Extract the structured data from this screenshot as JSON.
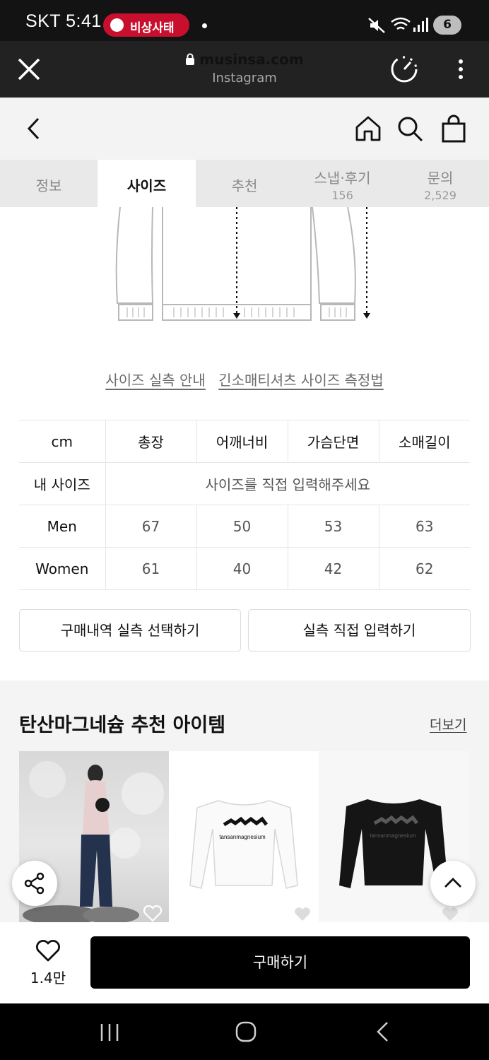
{
  "status_bar": {
    "carrier_time": "SKT 5:41",
    "notification": "비상사태",
    "battery": "6"
  },
  "browser": {
    "domain": "musinsa.com",
    "source": "Instagram"
  },
  "tabs": [
    {
      "label": "정보",
      "count": ""
    },
    {
      "label": "사이즈",
      "count": ""
    },
    {
      "label": "추천",
      "count": ""
    },
    {
      "label": "스냅·후기",
      "count": "156"
    },
    {
      "label": "문의",
      "count": "2,529"
    }
  ],
  "guides": {
    "actual_size": "사이즈 실측 안내",
    "measure_method": "긴소매티셔츠 사이즈 측정법"
  },
  "size_table": {
    "headers": [
      "cm",
      "총장",
      "어깨너비",
      "가슴단면",
      "소매길이"
    ],
    "my_size": {
      "label": "내 사이즈",
      "prompt": "사이즈를 직접 입력해주세요"
    },
    "rows": [
      {
        "label": "Men",
        "values": [
          "67",
          "50",
          "53",
          "63"
        ]
      },
      {
        "label": "Women",
        "values": [
          "61",
          "40",
          "42",
          "62"
        ]
      }
    ]
  },
  "buttons": {
    "select_history": "구매내역 실측 선택하기",
    "manual_input": "실측 직접 입력하기"
  },
  "recommend": {
    "title": "탄산마그네슘 추천 아이템",
    "more": "더보기",
    "print_text": "tansanmagnesium"
  },
  "purchase": {
    "likes": "1.4만",
    "buy": "구매하기"
  }
}
